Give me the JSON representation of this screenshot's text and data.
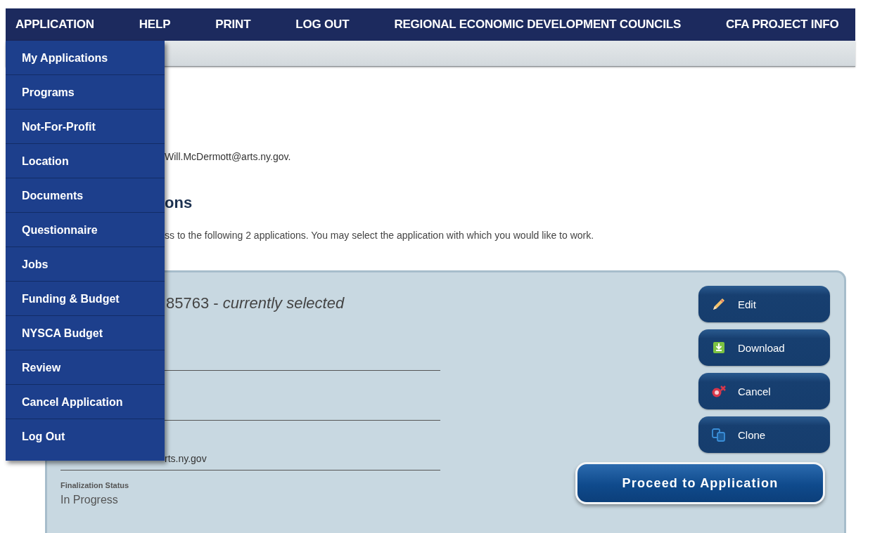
{
  "nav": [
    "APPLICATION",
    "HELP",
    "PRINT",
    "LOG OUT",
    "REGIONAL ECONOMIC DEVELOPMENT COUNCILS",
    "CFA PROJECT INFO"
  ],
  "application_menu": [
    "My Applications",
    "Programs",
    "Not-For-Profit",
    "Location",
    "Documents",
    "Questionnaire",
    "Jobs",
    "Funding & Budget",
    "NYSCA Budget",
    "Review",
    "Cancel Application",
    "Log Out"
  ],
  "content": {
    "email": "Will.McDermott@arts.ny.gov",
    "email_end": ".",
    "heading": "ons",
    "intro": "ss to the following 2 applications. You may select the application with which you would like to work."
  },
  "application_card": {
    "title": "85763 - *currently selected*",
    "fields": [
      {
        "value": "rts.ny.gov"
      },
      {
        "label": "Finalization Status",
        "value": "In Progress"
      }
    ],
    "actions": [
      {
        "kind": "edit",
        "label": "Edit"
      },
      {
        "kind": "download",
        "label": "Download"
      },
      {
        "kind": "cancel",
        "label": "Cancel"
      },
      {
        "kind": "clone",
        "label": "Clone"
      }
    ],
    "proceed": "Proceed to Application"
  }
}
